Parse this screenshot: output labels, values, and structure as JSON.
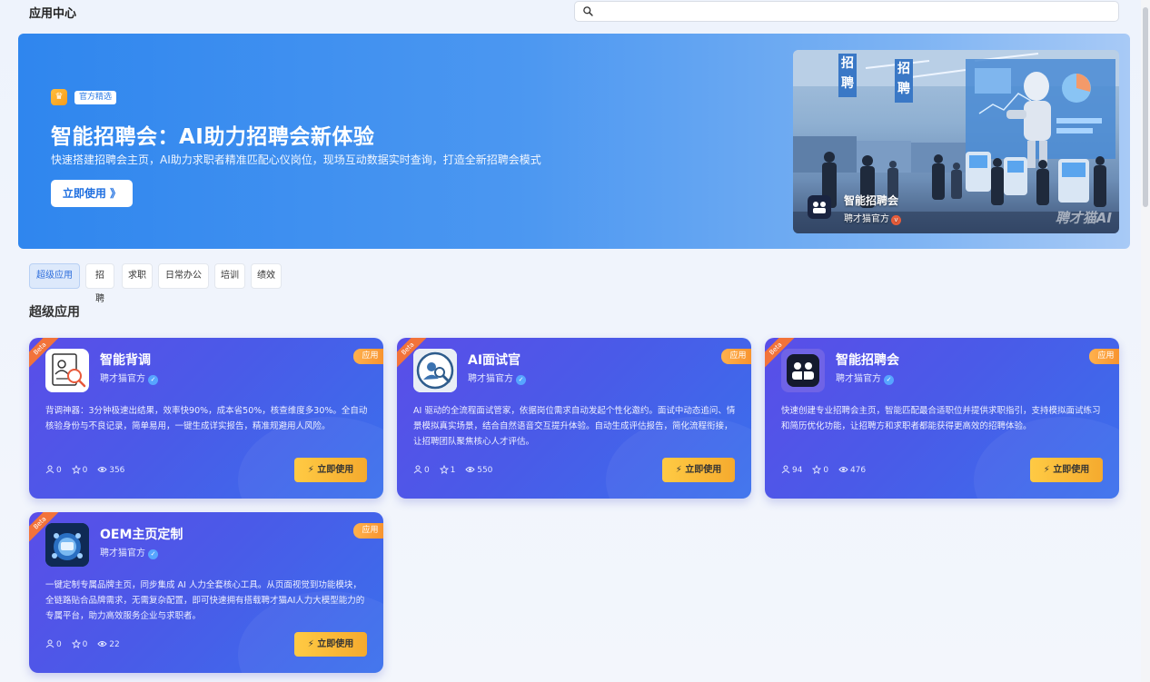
{
  "header": {
    "title": "应用中心",
    "search_placeholder": "",
    "search_value": ""
  },
  "banner": {
    "badge": "官方精选",
    "title": "智能招聘会：AI助力招聘会新体验",
    "description": "快速搭建招聘会主页，AI助力求职者精准匹配心仪岗位，现场互动数据实时查询，打造全新招聘会模式",
    "cta_label": "立即使用 》",
    "image_caption_title": "智能招聘会",
    "image_caption_author": "聘才猫官方",
    "image_caption_badge": "v",
    "image_watermark": "聘才猫AI",
    "image_sign_1": "招聘",
    "image_sign_2": "招聘",
    "dots": 4,
    "active_dot": 2
  },
  "tabs": [
    {
      "label": "超级应用",
      "active": true
    },
    {
      "label": "招聘",
      "active": false
    },
    {
      "label": "求职",
      "active": false
    },
    {
      "label": "日常办公",
      "active": false
    },
    {
      "label": "培训",
      "active": false
    },
    {
      "label": "绩效",
      "active": false
    }
  ],
  "section_title": "超级应用",
  "cards": [
    {
      "ribbon": "Beta",
      "title": "智能背调",
      "author": "聘才猫官方",
      "badge": "应用",
      "description": "背调神器：3分钟极速出结果，效率快90%，成本省50%，核查维度多30%。全自动核验身份与不良记录，简单易用，一键生成详实报告，精准规避用人风险。",
      "users": "0",
      "stars": "0",
      "views": "356",
      "cta_label": "⚡ 立即使用",
      "logo": "background-check-logo"
    },
    {
      "ribbon": "Beta",
      "title": "AI面试官",
      "author": "聘才猫官方",
      "badge": "应用",
      "description": "AI 驱动的全流程面试管家，依据岗位需求自动发起个性化邀约。面试中动态追问、情景模拟真实场景，结合自然语音交互提升体验。自动生成评估报告，简化流程衔接，让招聘团队聚焦核心人才评估。",
      "users": "0",
      "stars": "1",
      "views": "550",
      "cta_label": "⚡ 立即使用",
      "logo": "ai-interviewer-logo"
    },
    {
      "ribbon": "Beta",
      "title": "智能招聘会",
      "author": "聘才猫官方",
      "badge": "应用",
      "description": "快速创建专业招聘会主页，智能匹配最合适职位并提供求职指引，支持模拟面试练习和简历优化功能，让招聘方和求职者都能获得更高效的招聘体验。",
      "users": "94",
      "stars": "0",
      "views": "476",
      "cta_label": "⚡ 立即使用",
      "logo": "job-fair-logo"
    },
    {
      "ribbon": "Beta",
      "title": "OEM主页定制",
      "author": "聘才猫官方",
      "badge": "应用",
      "description": "一键定制专属品牌主页，同步集成 AI 人力全套核心工具。从页面视觉到功能模块，全链路贴合品牌需求，无需复杂配置，即可快速拥有搭载聘才猫AI人力大模型能力的专属平台，助力高效服务企业与求职者。",
      "users": "0",
      "stars": "0",
      "views": "22",
      "cta_label": "⚡ 立即使用",
      "logo": "oem-homepage-logo"
    }
  ]
}
